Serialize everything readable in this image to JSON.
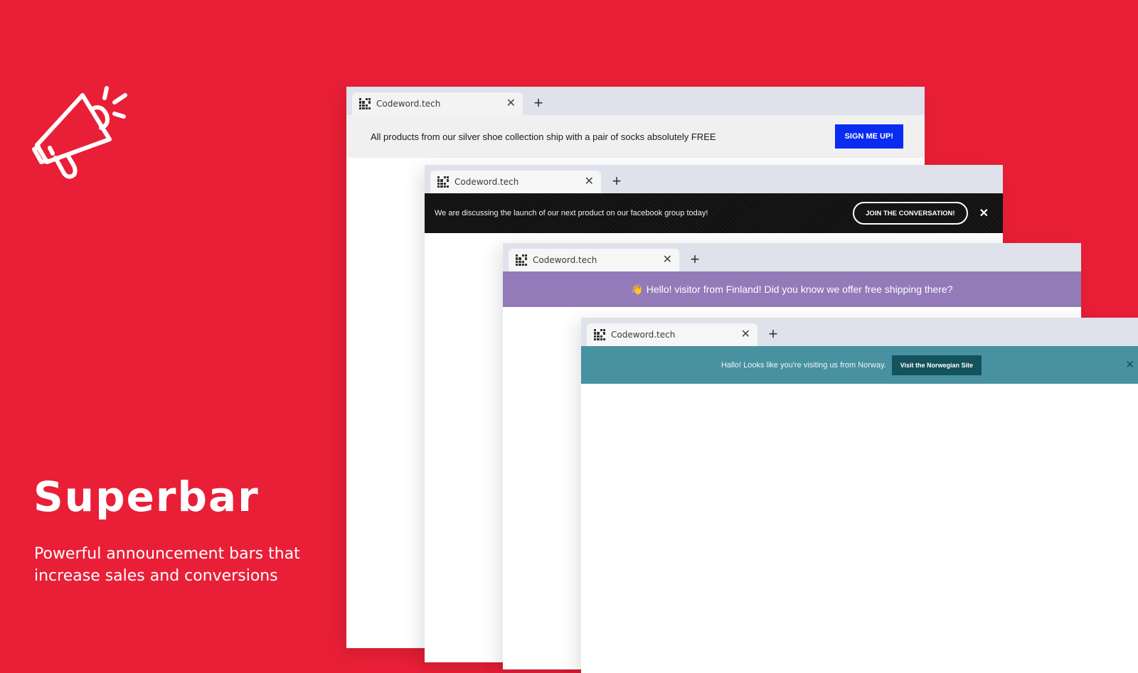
{
  "hero": {
    "icon": "megaphone-icon",
    "title": "Superbar",
    "subtitle": "Powerful announcement bars that increase sales and conversions"
  },
  "browsers": [
    {
      "tab_title": "Codeword.tech",
      "bar": {
        "message": "All products from our silver shoe collection ship with a pair of socks absolutely FREE",
        "button_label": "SIGN ME UP!",
        "background": "#f0f0f0",
        "button_color": "#0a2cf0"
      }
    },
    {
      "tab_title": "Codeword.tech",
      "bar": {
        "message": "We are discussing the launch of our next product on our facebook group today!",
        "button_label": "JOIN THE CONVERSATION!",
        "close_label": "✕",
        "background": "#0d0d0d"
      }
    },
    {
      "tab_title": "Codeword.tech",
      "bar": {
        "message": "👋 Hello! visitor from Finland! Did you know we offer free shipping there?",
        "background": "#937ab9"
      }
    },
    {
      "tab_title": "Codeword.tech",
      "bar": {
        "message": "Hallo! Looks like you're visiting us from Norway.",
        "button_label": "Visit the Norwegian Site",
        "close_label": "✕",
        "background": "#4791a1",
        "button_color": "#14525c"
      }
    }
  ],
  "tab_close_label": "✕",
  "new_tab_label": "+",
  "colors": {
    "background": "#e91f37",
    "tabstrip": "#dfe2ea"
  }
}
